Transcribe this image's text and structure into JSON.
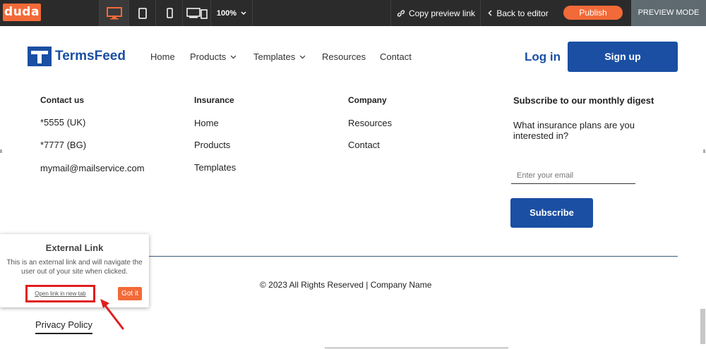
{
  "editor": {
    "logo": "duda",
    "zoom": "100%",
    "copy_preview": "Copy preview link",
    "back": "Back to editor",
    "publish": "Publish",
    "mode": "PREVIEW MODE"
  },
  "site": {
    "brand": "TermsFeed",
    "nav": [
      "Home",
      "Products",
      "Templates",
      "Resources",
      "Contact"
    ],
    "login": "Log in",
    "signup": "Sign up"
  },
  "footer": {
    "contact": {
      "heading": "Contact us",
      "items": [
        "*5555 (UK)",
        "*7777 (BG)",
        "mymail@mailservice.com"
      ]
    },
    "insurance": {
      "heading": "Insurance",
      "items": [
        "Home",
        "Products",
        "Templates"
      ]
    },
    "company": {
      "heading": "Company",
      "items": [
        "Resources",
        "Contact"
      ]
    },
    "subscribe": {
      "heading": "Subscribe to our monthly digest",
      "question": "What insurance plans are you interested in?",
      "placeholder": "Enter your email",
      "button": "Subscribe"
    },
    "copyright": "© 2023 All Rights Reserved | Company Name",
    "privacy": "Privacy Policy"
  },
  "popup": {
    "title": "External Link",
    "text": "This is an external link and will navigate the user out of your site when clicked.",
    "open_link": "Open link in new tab",
    "got_it": "Got it"
  },
  "colors": {
    "accent": "#f26a38",
    "brand": "#1a4fa3",
    "highlight": "#e01e1e"
  }
}
